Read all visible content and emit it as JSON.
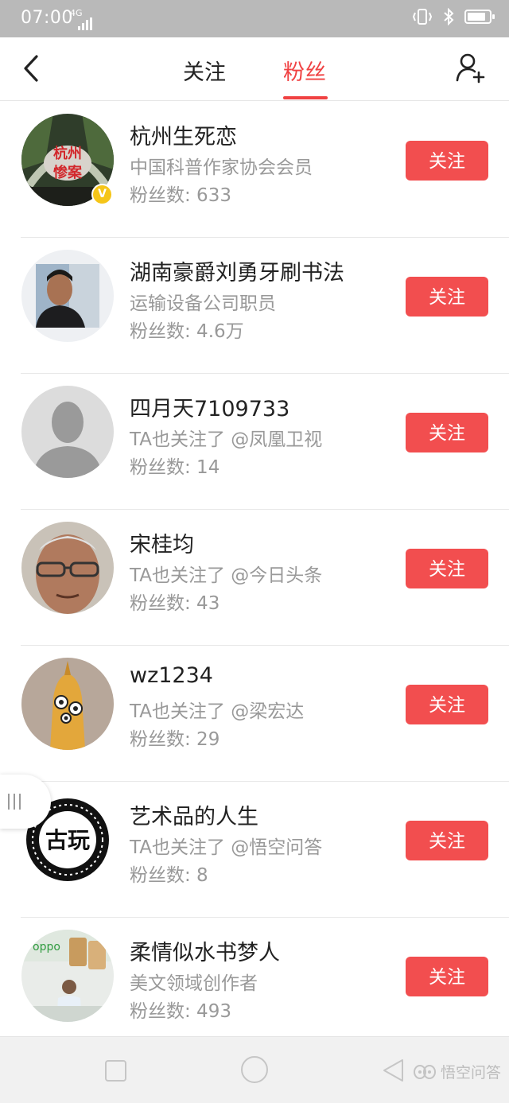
{
  "status_bar": {
    "time": "07:00",
    "network": "4G",
    "battery_level": 0.85
  },
  "header": {
    "tabs": [
      {
        "label": "关注",
        "active": false
      },
      {
        "label": "粉丝",
        "active": true
      }
    ],
    "accent_color": "#f04142"
  },
  "followers": [
    {
      "name": "杭州生死恋",
      "desc": "中国科普作家协会会员",
      "fans": "粉丝数: 633",
      "button": "关注",
      "verified": true,
      "verified_mark": "V",
      "avatar_text": [
        "杭州",
        "惨案"
      ]
    },
    {
      "name": "湖南豪爵刘勇牙刷书法",
      "desc": "运输设备公司职员",
      "fans": "粉丝数: 4.6万",
      "button": "关注",
      "verified": false
    },
    {
      "name": "四月天7109733",
      "desc": "TA也关注了 @凤凰卫视",
      "fans": "粉丝数: 14",
      "button": "关注",
      "verified": false
    },
    {
      "name": "宋桂均",
      "desc": "TA也关注了 @今日头条",
      "fans": "粉丝数: 43",
      "button": "关注",
      "verified": false
    },
    {
      "name": "wz1234",
      "desc": "TA也关注了 @梁宏达",
      "fans": "粉丝数: 29",
      "button": "关注",
      "verified": false
    },
    {
      "name": "艺术品的人生",
      "desc": "TA也关注了 @悟空问答",
      "fans": "粉丝数: 8",
      "button": "关注",
      "verified": false,
      "avatar_text": [
        "古玩"
      ]
    },
    {
      "name": "柔情似水书梦人",
      "desc": "美文领域创作者",
      "fans": "粉丝数: 493",
      "button": "关注",
      "verified": false,
      "avatar_text": [
        "oppo"
      ]
    }
  ],
  "watermark": "悟空问答",
  "colors": {
    "button": "#f24e4f",
    "status_bar": "#b9b9b9",
    "secondary_text": "#999999"
  },
  "icons": {
    "back": "chevron-left-icon",
    "add_user": "add-user-icon",
    "side_handle": "menu-bars-icon",
    "nav": [
      "square-icon",
      "circle-icon",
      "triangle-back-icon"
    ]
  }
}
